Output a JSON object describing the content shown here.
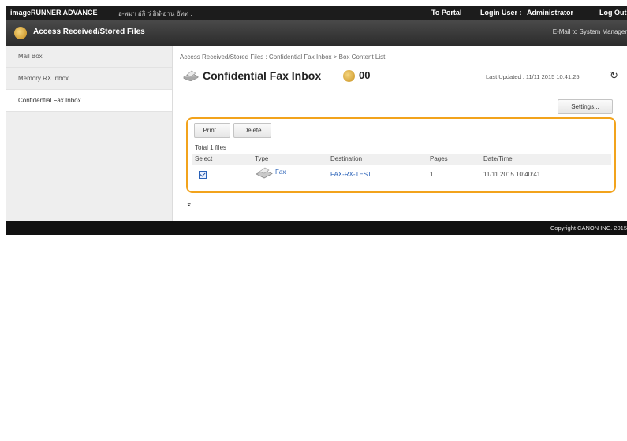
{
  "topbar": {
    "brand": "imageRUNNER ADVANCE",
    "host": "ฮ-พมฯ ฮ่กิ ว่ ฮิฬ-ฮาน ฮัทท .",
    "to_portal": "To Portal",
    "login_label": "Login User :",
    "login_user": "Administrator",
    "logout": "Log Out"
  },
  "titlebar": {
    "title": "Access Received/Stored Files",
    "mail_link": "E-Mail to System Manager"
  },
  "sidebar": {
    "items": [
      {
        "label": "Mail Box"
      },
      {
        "label": "Memory RX Inbox"
      },
      {
        "label": "Confidential Fax Inbox"
      }
    ]
  },
  "main": {
    "breadcrumb": "Access Received/Stored Files : Confidential Fax Inbox > Box Content List",
    "title": "Confidential Fax Inbox",
    "box_number": "00",
    "last_updated": "Last Updated : 11/11 2015 10:41:25",
    "settings_button": "Settings...",
    "print_button": "Print...",
    "delete_button": "Delete",
    "total": "Total 1 files",
    "table": {
      "headers": [
        "Select",
        "Type",
        "Destination",
        "Pages",
        "Date/Time"
      ],
      "rows": [
        {
          "selected": true,
          "type": "Fax",
          "destination": "FAX-RX-TEST",
          "pages": "1",
          "datetime": "11/11 2015 10:40:41"
        }
      ]
    },
    "jump_to_top": "⌅"
  },
  "footer": {
    "copyright": "Copyright CANON INC. 2015"
  },
  "colors": {
    "highlight": "#f2a31c",
    "link": "#2a62b8",
    "topbar": "#1c1c1c"
  },
  "icons": {
    "app": "mailbox-icon",
    "title": "fax-machine-icon",
    "box": "box-icon",
    "refresh": "refresh-icon"
  }
}
